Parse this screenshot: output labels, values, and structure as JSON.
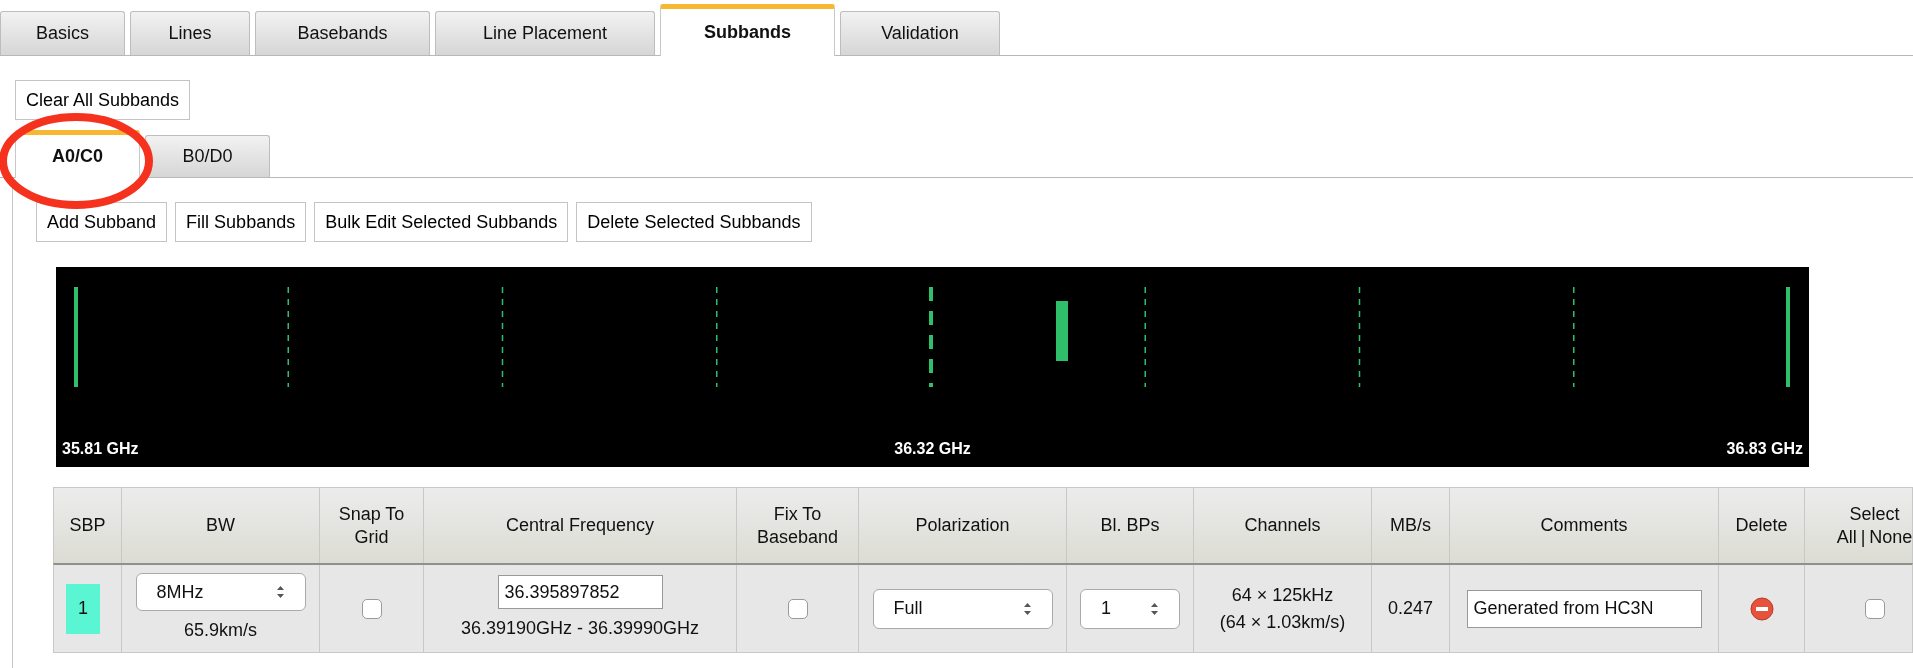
{
  "tabs": [
    {
      "label": "Basics",
      "selected": false
    },
    {
      "label": "Lines",
      "selected": false
    },
    {
      "label": "Basebands",
      "selected": false
    },
    {
      "label": "Line Placement",
      "selected": false
    },
    {
      "label": "Subbands",
      "selected": true
    },
    {
      "label": "Validation",
      "selected": false
    }
  ],
  "clear_button": "Clear All Subbands",
  "subtabs": [
    {
      "label": "A0/C0",
      "selected": true
    },
    {
      "label": "B0/D0",
      "selected": false
    }
  ],
  "action_buttons": [
    "Add Subband",
    "Fill Subbands",
    "Bulk Edit Selected Subbands",
    "Delete Selected Subbands"
  ],
  "spectrum": {
    "labels": [
      "35.81 GHz",
      "36.32 GHz",
      "36.83 GHz"
    ]
  },
  "table": {
    "columns": [
      {
        "label": "SBP"
      },
      {
        "label": "BW"
      },
      {
        "label": "Snap To Grid"
      },
      {
        "label": "Central Frequency"
      },
      {
        "label": "Fix To Baseband"
      },
      {
        "label": "Polarization"
      },
      {
        "label": "Bl. BPs"
      },
      {
        "label": "Channels"
      },
      {
        "label": "MB/s"
      },
      {
        "label": "Comments"
      },
      {
        "label": "Delete"
      },
      {
        "label": "Select",
        "links": [
          "All",
          "|",
          "None"
        ]
      }
    ],
    "rows": [
      {
        "sbp": "1",
        "color": "#5af5d2",
        "bw": "8MHz",
        "velocity": "65.9km/s",
        "snap_to_grid": false,
        "central_frequency": "36.395897852",
        "range": "36.39190GHz - 36.39990GHz",
        "fix_to_baseband": false,
        "polarization": "Full",
        "bl_bps": "1",
        "channels": [
          "64 × 125kHz",
          "(64 × 1.03km/s)"
        ],
        "mbs": "0.247",
        "comments": "Generated from HC3N",
        "selected": false
      }
    ]
  },
  "annotation": {
    "kind": "circle",
    "color": "#f5321e"
  }
}
